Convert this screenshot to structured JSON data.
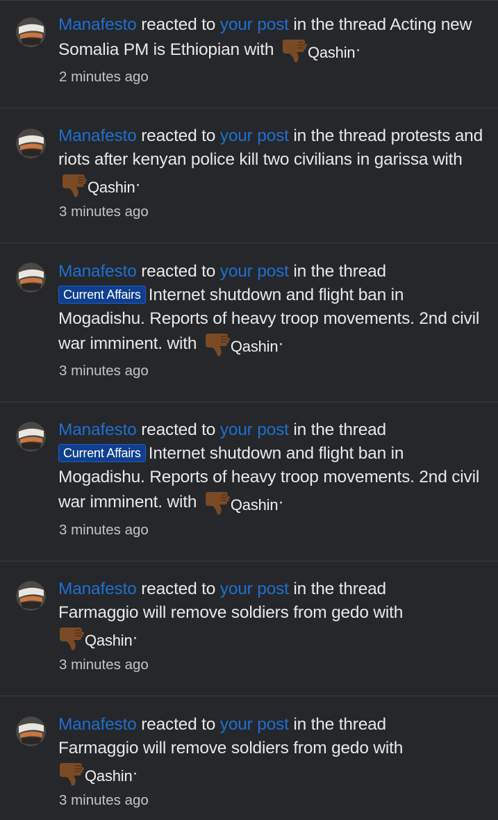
{
  "alerts": [
    {
      "username": "Manafesto",
      "action": " reacted to ",
      "post_link": "your post",
      "thread_prefix_text": " in the thread ",
      "thread_label": "",
      "thread_title": "Acting new Somalia PM is Ethiopian with",
      "reaction_icon": "thumbs-down-icon",
      "reaction_name": "Qashin",
      "reaction_suffix": "·",
      "time": "2 minutes ago"
    },
    {
      "username": "Manafesto",
      "action": " reacted to ",
      "post_link": "your post",
      "thread_prefix_text": " in the thread ",
      "thread_label": "",
      "thread_title": "protests and riots after kenyan police kill two civilians in garissa with",
      "reaction_icon": "thumbs-down-icon",
      "reaction_name": "Qashin",
      "reaction_suffix": "·",
      "time": "3 minutes ago"
    },
    {
      "username": "Manafesto",
      "action": " reacted to ",
      "post_link": "your post",
      "thread_prefix_text": " in the thread ",
      "thread_label": "Current Affairs",
      "thread_title": "Internet shutdown and flight ban in Mogadishu. Reports of heavy troop movements. 2nd civil war imminent. with",
      "reaction_icon": "thumbs-down-icon",
      "reaction_name": "Qashin",
      "reaction_suffix": "·",
      "time": "3 minutes ago"
    },
    {
      "username": "Manafesto",
      "action": " reacted to ",
      "post_link": "your post",
      "thread_prefix_text": " in the thread ",
      "thread_label": "Current Affairs",
      "thread_title": "Internet shutdown and flight ban in Mogadishu. Reports of heavy troop movements. 2nd civil war imminent. with",
      "reaction_icon": "thumbs-down-icon",
      "reaction_name": "Qashin",
      "reaction_suffix": "·",
      "time": "3 minutes ago"
    },
    {
      "username": "Manafesto",
      "action": " reacted to ",
      "post_link": "your post",
      "thread_prefix_text": " in the thread ",
      "thread_label": "",
      "thread_title": "Farmaggio will remove soldiers from gedo with",
      "reaction_icon": "thumbs-down-icon",
      "reaction_name": "Qashin",
      "reaction_suffix": "·",
      "time": "3 minutes ago"
    },
    {
      "username": "Manafesto",
      "action": " reacted to ",
      "post_link": "your post",
      "thread_prefix_text": " in the thread ",
      "thread_label": "",
      "thread_title": "Farmaggio will remove soldiers from gedo with",
      "reaction_icon": "thumbs-down-icon",
      "reaction_name": "Qashin",
      "reaction_suffix": "·",
      "time": "3 minutes ago"
    }
  ],
  "colors": {
    "background": "#25272b",
    "link": "#1f6fd0",
    "badge": "#0f3f8e",
    "divider": "#3a3d42",
    "reaction": "#7a4a25"
  }
}
